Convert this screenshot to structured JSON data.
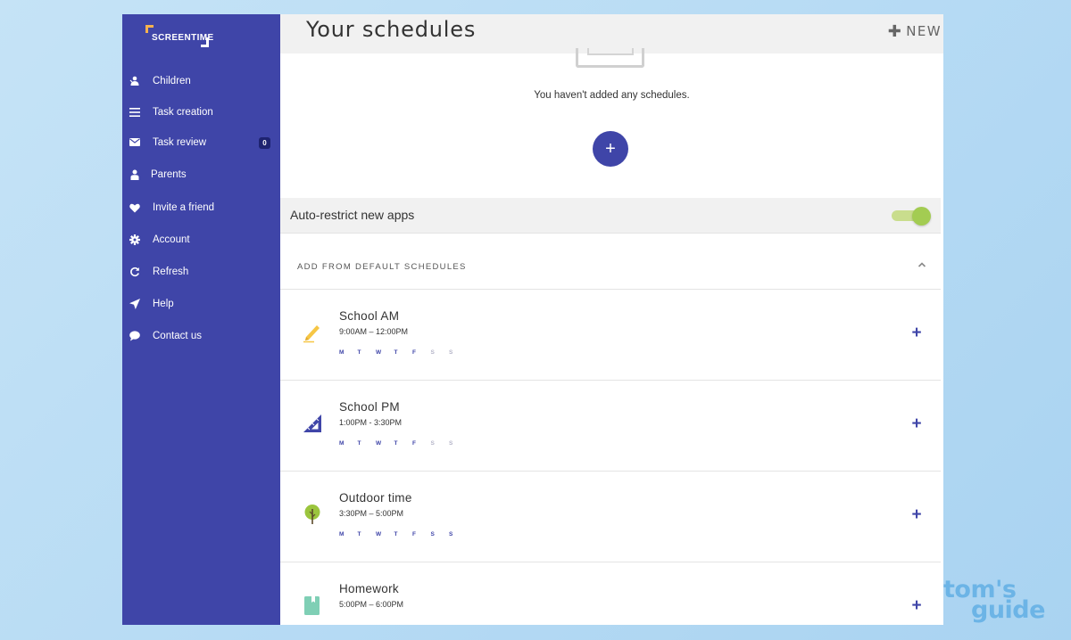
{
  "app": {
    "brand": "SCREENTIME"
  },
  "sidebar": {
    "items": [
      {
        "label": "Children",
        "icon": "child-icon"
      },
      {
        "label": "Task creation",
        "icon": "list-icon"
      },
      {
        "label": "Task review",
        "icon": "envelope-icon",
        "badge": "0"
      },
      {
        "label": "Parents",
        "icon": "person-icon"
      },
      {
        "label": "Invite a friend",
        "icon": "heart-icon"
      },
      {
        "label": "Account",
        "icon": "gear-icon"
      },
      {
        "label": "Refresh",
        "icon": "refresh-icon"
      },
      {
        "label": "Help",
        "icon": "send-icon"
      },
      {
        "label": "Contact us",
        "icon": "chat-bubble-icon"
      }
    ]
  },
  "header": {
    "title": "Your schedules",
    "new_label": "NEW"
  },
  "empty": {
    "message": "You haven't added any schedules.",
    "add_symbol": "+"
  },
  "restrict": {
    "label": "Auto-restrict new apps",
    "enabled": true
  },
  "defaults": {
    "label": "ADD FROM DEFAULT SCHEDULES",
    "expanded": true,
    "schedules": [
      {
        "name": "School AM",
        "time": "9:00AM – 12:00PM",
        "icon": "pencil-icon",
        "days": [
          {
            "d": "M",
            "on": true
          },
          {
            "d": "T",
            "on": true
          },
          {
            "d": "W",
            "on": true
          },
          {
            "d": "T",
            "on": true
          },
          {
            "d": "F",
            "on": true
          },
          {
            "d": "S",
            "on": false
          },
          {
            "d": "S",
            "on": false
          }
        ]
      },
      {
        "name": "School PM",
        "time": "1:00PM - 3:30PM",
        "icon": "ruler-triangle-icon",
        "days": [
          {
            "d": "M",
            "on": true
          },
          {
            "d": "T",
            "on": true
          },
          {
            "d": "W",
            "on": true
          },
          {
            "d": "T",
            "on": true
          },
          {
            "d": "F",
            "on": true
          },
          {
            "d": "S",
            "on": false
          },
          {
            "d": "S",
            "on": false
          }
        ]
      },
      {
        "name": "Outdoor time",
        "time": "3:30PM – 5:00PM",
        "icon": "tree-icon",
        "days": [
          {
            "d": "M",
            "on": true
          },
          {
            "d": "T",
            "on": true
          },
          {
            "d": "W",
            "on": true
          },
          {
            "d": "T",
            "on": true
          },
          {
            "d": "F",
            "on": true
          },
          {
            "d": "S",
            "on": true
          },
          {
            "d": "S",
            "on": true
          }
        ]
      },
      {
        "name": "Homework",
        "time": "5:00PM – 6:00PM",
        "icon": "book-icon",
        "days": []
      }
    ]
  },
  "watermark": {
    "line1": "tom's",
    "line2": "guide"
  },
  "colors": {
    "sidebar": "#3f45a8",
    "accent": "#3f45a8",
    "toggle_on": "#a3cc52",
    "pencil": "#f6c644",
    "tree": "#9bc53d",
    "book": "#7fcfb5"
  }
}
